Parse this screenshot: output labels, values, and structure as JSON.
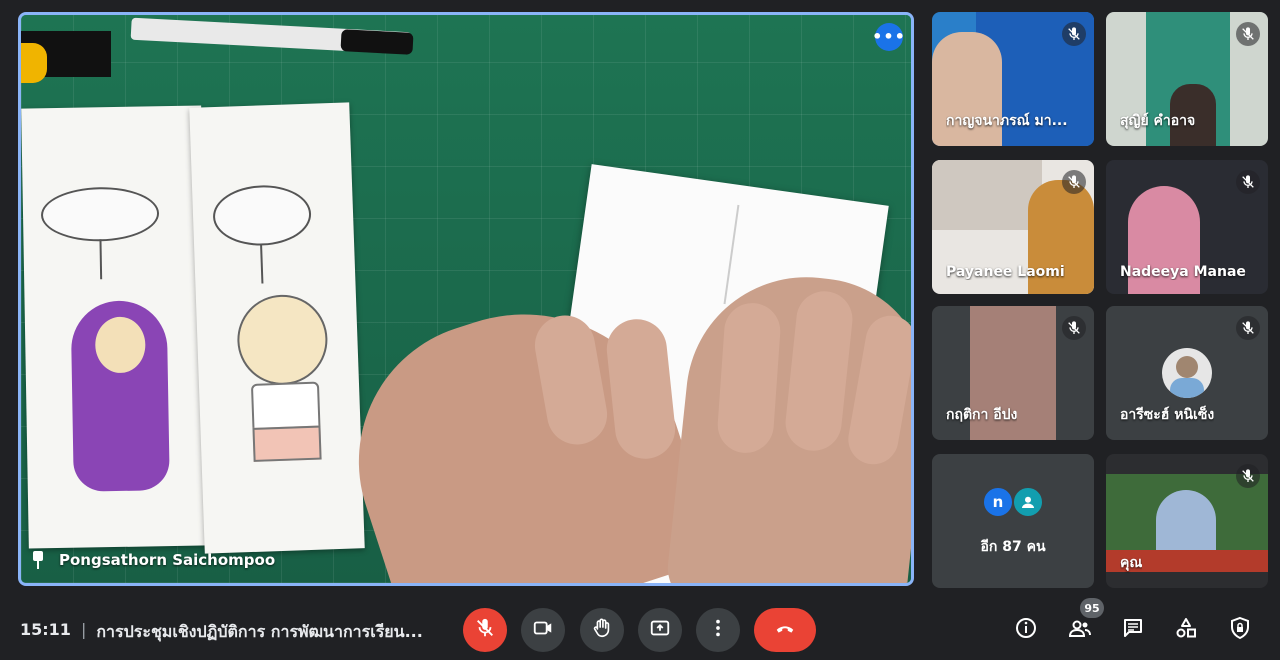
{
  "presenter": {
    "name": "Pongsathorn Saichompoo"
  },
  "participants": [
    {
      "name": "กาญจนาภรณ์ มา..."
    },
    {
      "name": "สุญิย์ คำอาจ"
    },
    {
      "name": "Payanee Laomi"
    },
    {
      "name": "Nadeeya Manae"
    },
    {
      "name": "กฤติกา อีปง"
    },
    {
      "name": "อารีซะฮ์ หนิเซ็ง"
    },
    {
      "name": "คุณ"
    }
  ],
  "more_participants": {
    "label": "อีก 87 คน",
    "avatar_letter": "n"
  },
  "bottom_bar": {
    "time": "15:11",
    "separator": "|",
    "meeting_title": "การประชุมเชิงปฏิบัติการ การพัฒนาการเรียน...",
    "people_count": "95"
  },
  "colors": {
    "accent": "#8ab4f8",
    "danger": "#ea4335",
    "tile_bg": "#3c4043"
  },
  "icons": {
    "main_more": "more-horiz-icon",
    "pin": "pin-icon",
    "mic_off": "mic-off-icon",
    "camera": "videocam-icon",
    "raise_hand": "raise-hand-icon",
    "present": "present-screen-icon",
    "more_vert": "more-vert-icon",
    "hangup": "call-end-icon",
    "info": "info-icon",
    "people": "people-icon",
    "chat": "chat-icon",
    "activities": "activities-icon",
    "host_controls": "shield-lock-icon"
  }
}
